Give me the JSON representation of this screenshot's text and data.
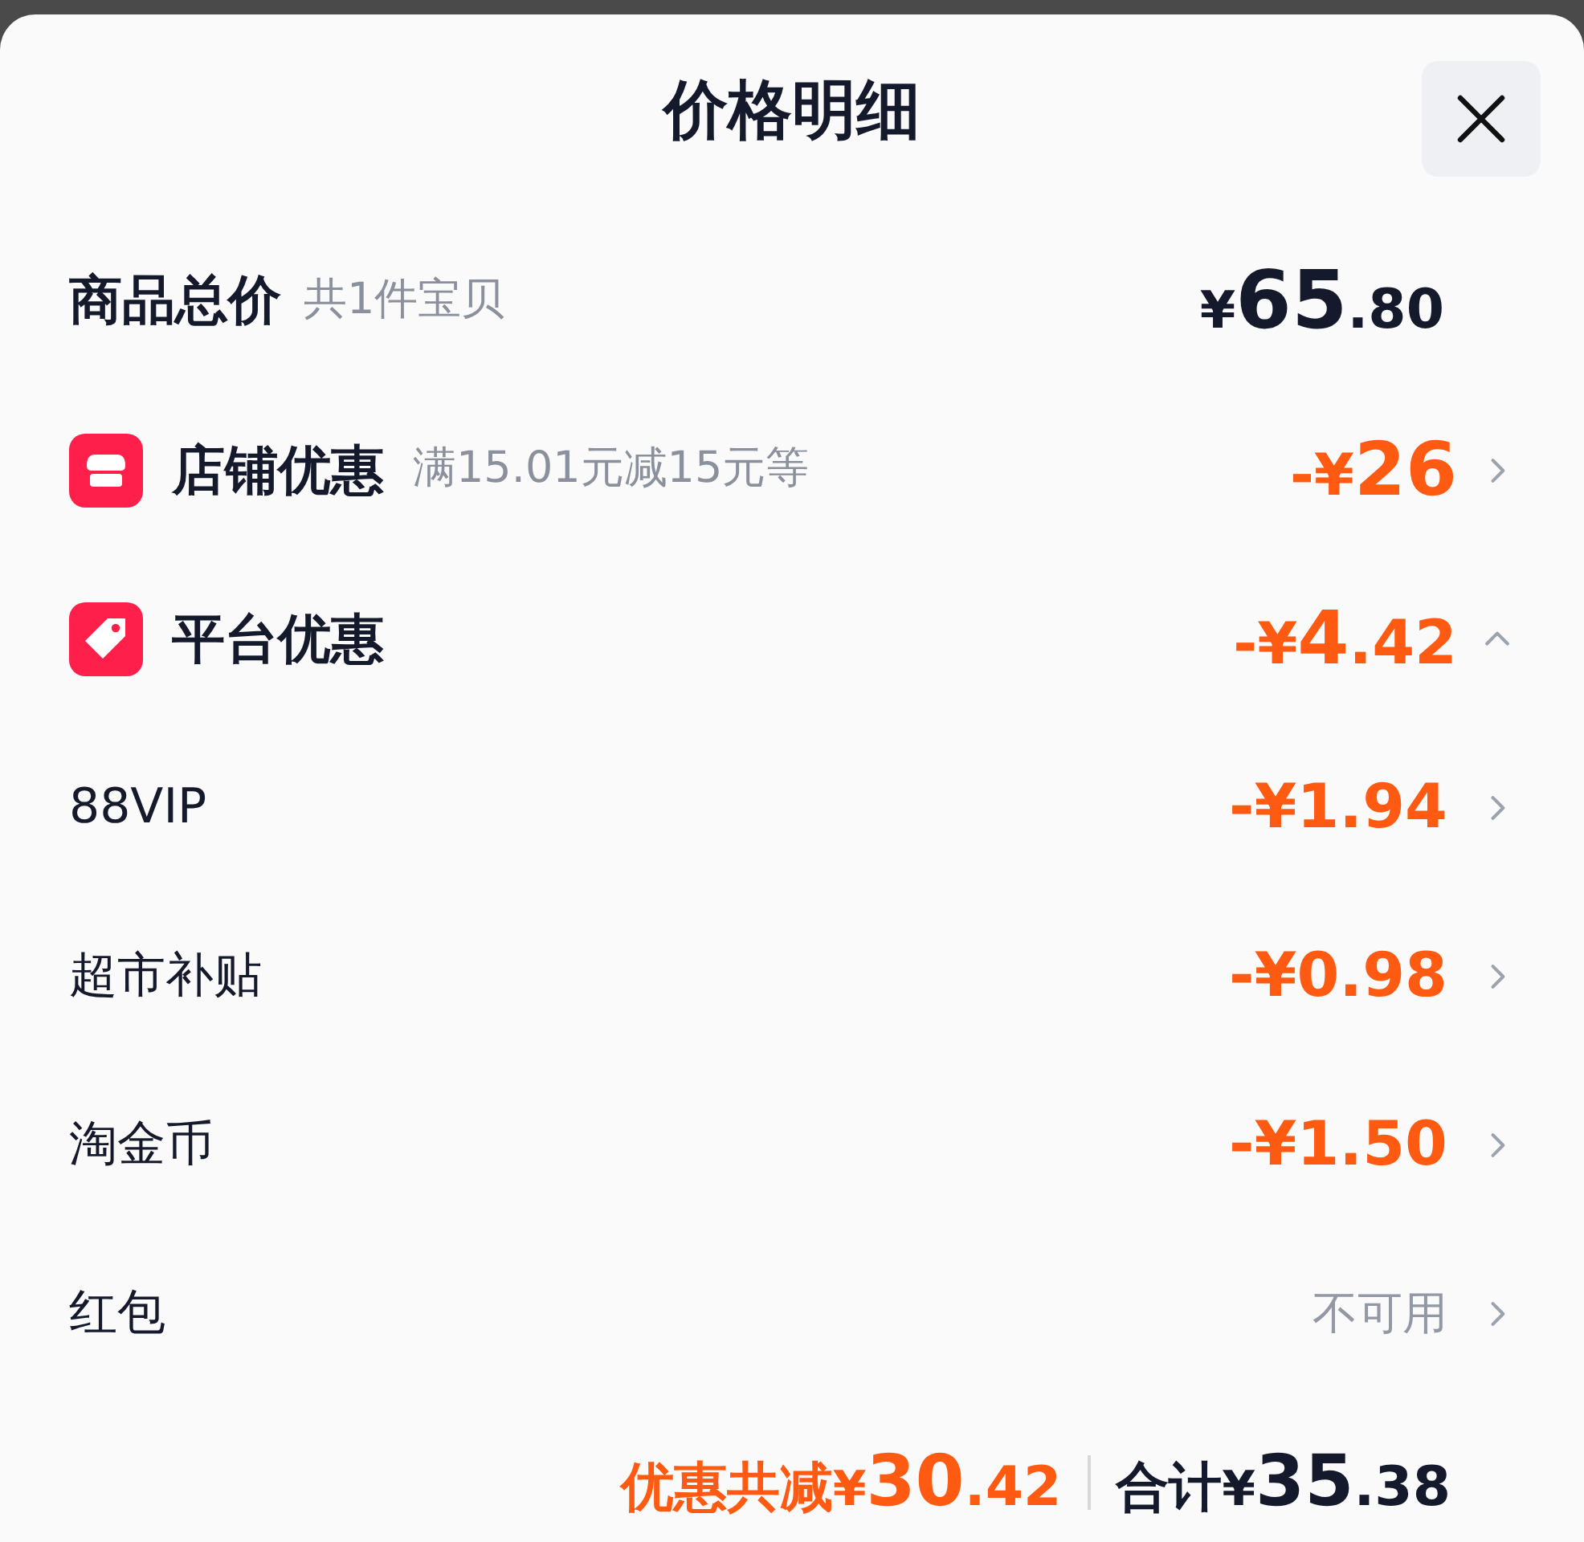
{
  "sheet": {
    "title": "价格明细"
  },
  "total": {
    "label": "商品总价",
    "note": "共1件宝贝",
    "currency": "¥",
    "integer": "65",
    "decimal": ".80"
  },
  "discounts": [
    {
      "kind": "store",
      "label": "店铺优惠",
      "note": "满15.01元减15元等",
      "amount_prefix": "-¥",
      "integer": "26",
      "expanded": false
    },
    {
      "kind": "tag",
      "label": "平台优惠",
      "amount_prefix": "-¥",
      "integer": "4",
      "decimal": ".42",
      "expanded": true,
      "children": [
        {
          "label": "88VIP",
          "kind": "amount",
          "value": "-¥1.94"
        },
        {
          "label": "超市补贴",
          "kind": "amount",
          "value": "-¥0.98"
        },
        {
          "label": "淘金币",
          "kind": "amount",
          "value": "-¥1.50"
        },
        {
          "label": "红包",
          "kind": "unavailable",
          "value": "不可用"
        }
      ]
    }
  ],
  "footer": {
    "saving_label": "优惠共减",
    "saving_currency": "¥",
    "saving_integer": "30",
    "saving_decimal": ".42",
    "total_label": "合计",
    "total_currency": "¥",
    "total_integer": "35",
    "total_decimal": ".38"
  }
}
